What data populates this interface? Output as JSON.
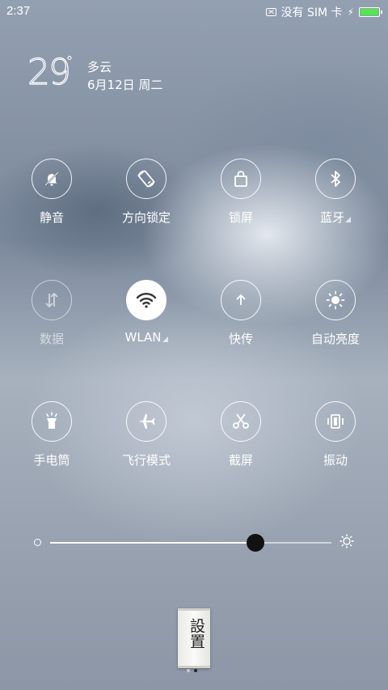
{
  "status": {
    "time": "2:37",
    "no_sim": "没有 SIM 卡",
    "battery_color": "#53e64f",
    "battery_level": 1.0
  },
  "weather": {
    "temperature": "29",
    "degree_symbol": "°",
    "condition": "多云",
    "date": "6月12日 周二"
  },
  "toggles": [
    {
      "label": "静音",
      "icon": "bell-muted-icon",
      "state": "off"
    },
    {
      "label": "方向锁定",
      "icon": "rotation-lock-icon",
      "state": "off"
    },
    {
      "label": "锁屏",
      "icon": "lock-screen-icon",
      "state": "off"
    },
    {
      "label": "蓝牙",
      "icon": "bluetooth-icon",
      "state": "off",
      "has_more": true
    },
    {
      "label": "数据",
      "icon": "data-arrows-icon",
      "state": "disabled"
    },
    {
      "label": "WLAN",
      "icon": "wifi-icon",
      "state": "on",
      "has_more": true
    },
    {
      "label": "快传",
      "icon": "upload-arrow-icon",
      "state": "off"
    },
    {
      "label": "自动亮度",
      "icon": "brightness-auto-icon",
      "state": "off"
    },
    {
      "label": "手电筒",
      "icon": "flashlight-icon",
      "state": "off"
    },
    {
      "label": "飞行模式",
      "icon": "airplane-icon",
      "state": "off"
    },
    {
      "label": "截屏",
      "icon": "scissors-icon",
      "state": "off"
    },
    {
      "label": "振动",
      "icon": "vibrate-icon",
      "state": "off"
    }
  ],
  "brightness": {
    "level": 0.73,
    "min_icon": "brightness-low-icon",
    "max_icon": "brightness-high-icon"
  },
  "settings_card": {
    "text": "設置",
    "page_index": 1,
    "page_count": 2
  }
}
